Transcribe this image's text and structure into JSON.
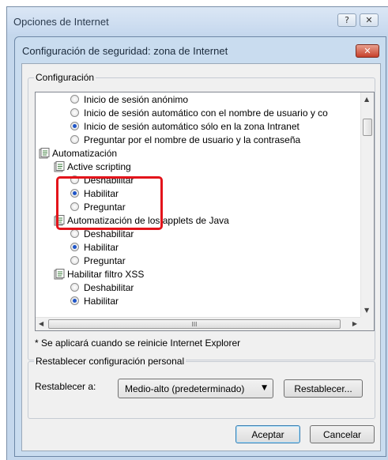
{
  "outer_window": {
    "title": "Opciones de Internet",
    "help_label": "?",
    "close_label": "✕"
  },
  "dialog": {
    "title": "Configuración de seguridad: zona de Internet",
    "close_label": "✕",
    "settings_group_label": "Configuración",
    "settings_items": [
      {
        "type": "option",
        "label": "Inicio de sesión anónimo",
        "checked": false
      },
      {
        "type": "option",
        "label": "Inicio de sesión automático con el nombre de usuario y co",
        "checked": false
      },
      {
        "type": "option",
        "label": "Inicio de sesión automático sólo en la zona Intranet",
        "checked": true
      },
      {
        "type": "option",
        "label": "Preguntar por el nombre de usuario y la contraseña",
        "checked": false
      },
      {
        "type": "category",
        "label": "Automatización",
        "icon": "settings-category-icon"
      },
      {
        "type": "setting",
        "label": "Active scripting",
        "icon": "settings-category-icon"
      },
      {
        "type": "option",
        "label": "Deshabilitar",
        "checked": false
      },
      {
        "type": "option",
        "label": "Habilitar",
        "checked": true
      },
      {
        "type": "option",
        "label": "Preguntar",
        "checked": false
      },
      {
        "type": "setting",
        "label": "Automatización de los applets de Java",
        "icon": "settings-category-icon"
      },
      {
        "type": "option",
        "label": "Deshabilitar",
        "checked": false
      },
      {
        "type": "option",
        "label": "Habilitar",
        "checked": true
      },
      {
        "type": "option",
        "label": "Preguntar",
        "checked": false
      },
      {
        "type": "setting",
        "label": "Habilitar filtro XSS",
        "icon": "settings-category-icon"
      },
      {
        "type": "option",
        "label": "Deshabilitar",
        "checked": false
      },
      {
        "type": "option",
        "label": "Habilitar",
        "checked": true
      }
    ],
    "scroll_up": "▲",
    "scroll_down": "▼",
    "scroll_left": "◀",
    "scroll_right": "▶",
    "hscroll_grip": "III",
    "note": "* Se aplicará cuando se reinicie Internet Explorer",
    "reset_group_label": "Restablecer configuración personal",
    "reset_to_label": "Restablecer a:",
    "reset_level_value": "Medio-alto (predeterminado)",
    "reset_button": "Restablecer...",
    "ok_button": "Aceptar",
    "cancel_button": "Cancelar"
  },
  "colors": {
    "highlight": "#e3141b",
    "title_bar": "#c9dcef",
    "radio_dot": "#1f55c8"
  }
}
